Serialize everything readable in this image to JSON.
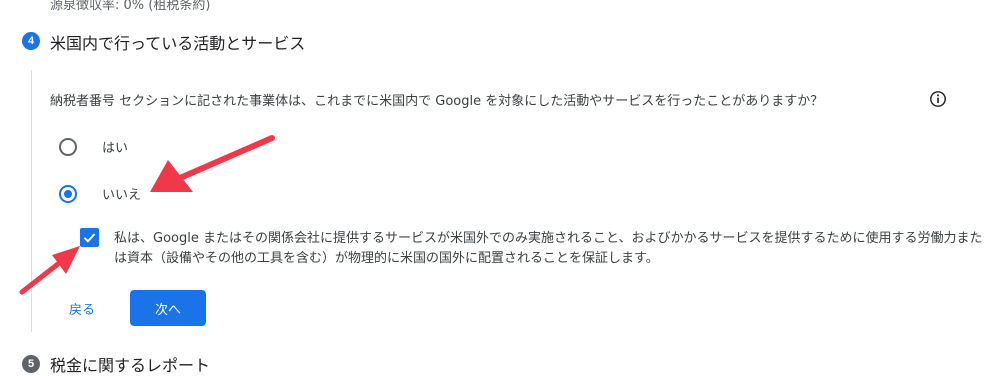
{
  "previous_step": {
    "cut_text": "源泉徴収率: 0% (租税条約)"
  },
  "current_step": {
    "number": "4",
    "title": "米国内で行っている活動とサービス",
    "question": "納税者番号 セクションに記された事業体は、これまでに米国内で Google を対象にした活動やサービスを行ったことがありますか？",
    "info_icon": "info-icon",
    "options": [
      {
        "label": "はい",
        "selected": false
      },
      {
        "label": "いいえ",
        "selected": true
      }
    ],
    "certification": {
      "checked": true,
      "text": "私は、Google またはその関係会社に提供するサービスが米国外でのみ実施されること、およびかかるサービスを提供するために使用する労働力または資本（設備やその他の工具を含む）が物理的に米国の国外に配置されることを保証します。"
    },
    "back_label": "戻る",
    "next_label": "次へ"
  },
  "next_step": {
    "number": "5",
    "title": "税金に関するレポート"
  },
  "colors": {
    "accent": "#1a73e8",
    "annotation_arrow": "#f0384a",
    "rail": "#dadce0"
  }
}
